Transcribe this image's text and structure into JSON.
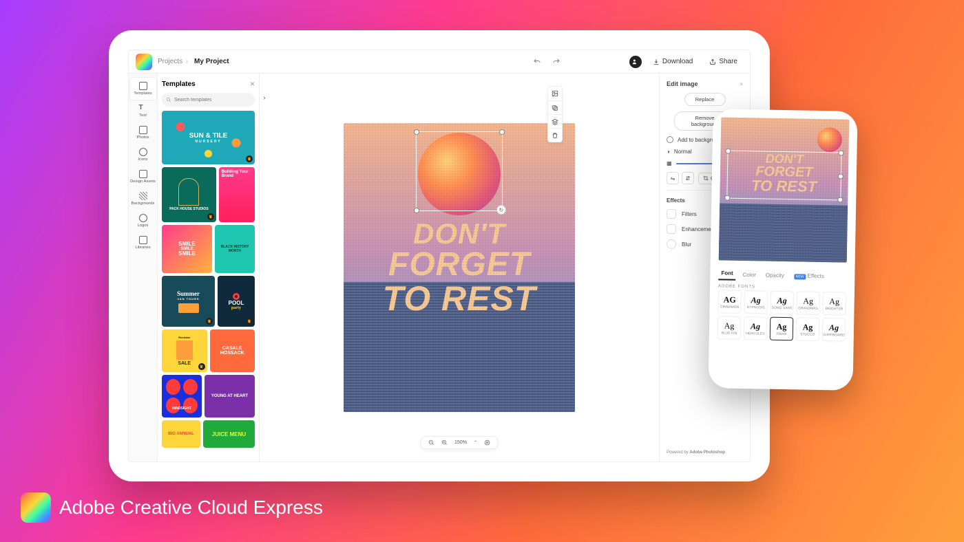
{
  "brand": {
    "name": "Adobe Creative Cloud Express"
  },
  "breadcrumb": {
    "root": "Projects",
    "project": "My Project"
  },
  "topbar": {
    "download": "Download",
    "share": "Share"
  },
  "leftnav": [
    {
      "label": "Templates",
      "active": true
    },
    {
      "label": "Text"
    },
    {
      "label": "Photos"
    },
    {
      "label": "Icons"
    },
    {
      "label": "Design Assets"
    },
    {
      "label": "Backgrounds"
    },
    {
      "label": "Logos"
    },
    {
      "label": "Libraries"
    }
  ],
  "templates_panel": {
    "title": "Templates",
    "search_placeholder": "Search templates",
    "items": {
      "sun_tile": "SUN & TILE",
      "sun_tile_sub": "NURSERY",
      "pack_house": "PACK HOUSE STUDIOS",
      "building_brand": "Building Your Brand",
      "smile": "SMILE",
      "bhm": "BLACK HISTORY MONTH",
      "summer": "Summer",
      "summer_sub": "VAN TOURS",
      "pool": "POOL",
      "pool_sub": "party",
      "rockstar": "Rockstar",
      "sale": "SALE",
      "casale": "CASALE HOSSACK",
      "hindsight": "HINDSIGHT",
      "young": "YOUNG AT HEART",
      "big_annual": "BIG ANNUAL",
      "juice": "JUICE MENU"
    }
  },
  "canvas": {
    "line1": "DON'T",
    "line2": "FORGET",
    "line3": "TO REST"
  },
  "zoom": {
    "value": "150%"
  },
  "right_panel": {
    "title": "Edit image",
    "replace": "Replace",
    "remove_bg": "Remove background",
    "add_to_bg": "Add to background",
    "blend_mode": "Normal",
    "crop": "Crop",
    "effects_label": "Effects",
    "filters": "Filters",
    "enhancements": "Enhancements",
    "blur": "Blur",
    "powered": "Powered by",
    "powered_by": "Adobe Photoshop"
  },
  "phone": {
    "tabs": {
      "font": "Font",
      "color": "Color",
      "opacity": "Opacity",
      "effects": "Effects"
    },
    "adobe_fonts": "ADOBE FONTS",
    "fonts": [
      "CINNAMON",
      "HYPNOSIS",
      "SONG SANS",
      "GRANDMAS",
      "BRIGHTER",
      "BLUE FIN",
      "HERCULES",
      "FRIAR",
      "STUCCO",
      "SURFBOARD"
    ]
  }
}
